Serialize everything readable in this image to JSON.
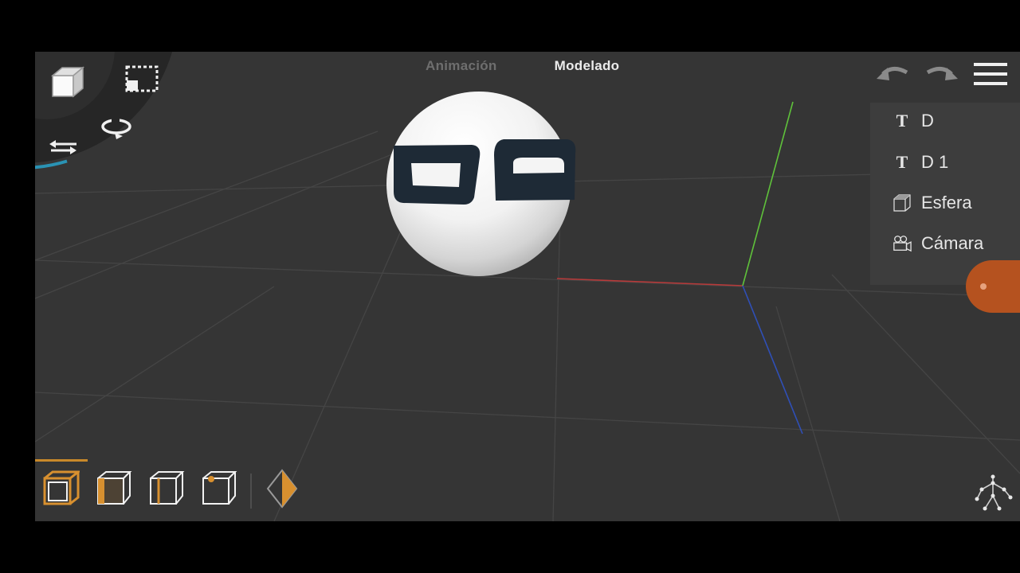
{
  "mode_tabs": [
    {
      "label": "Animación",
      "active": false
    },
    {
      "label": "Modelado",
      "active": true
    }
  ],
  "tools": {
    "icons": [
      "cube-view-icon",
      "box-select-icon",
      "rotate-icon",
      "move-icon"
    ]
  },
  "top_right": {
    "icons": [
      "undo-icon",
      "redo-icon",
      "hamburger-menu-icon"
    ]
  },
  "outliner": {
    "items": [
      {
        "label": "D",
        "icon": "text-object-icon"
      },
      {
        "label": "D 1",
        "icon": "text-object-icon"
      },
      {
        "label": "Esfera",
        "icon": "mesh-object-icon"
      },
      {
        "label": "Cámara",
        "icon": "camera-object-icon"
      }
    ]
  },
  "viewport": {
    "axis_colors": {
      "x": "#b83a3a",
      "y": "#5fc13b",
      "z": "#2f4fb7"
    },
    "sphere_color": "#ffffff",
    "letters_color": "#1e2a36"
  },
  "bottom_bar": {
    "selection_modes": [
      "object-mode-icon",
      "face-mode-icon",
      "edge-mode-icon",
      "vertex-mode-icon"
    ],
    "active_mode": "object-mode-icon",
    "accent": "#c9892a"
  }
}
